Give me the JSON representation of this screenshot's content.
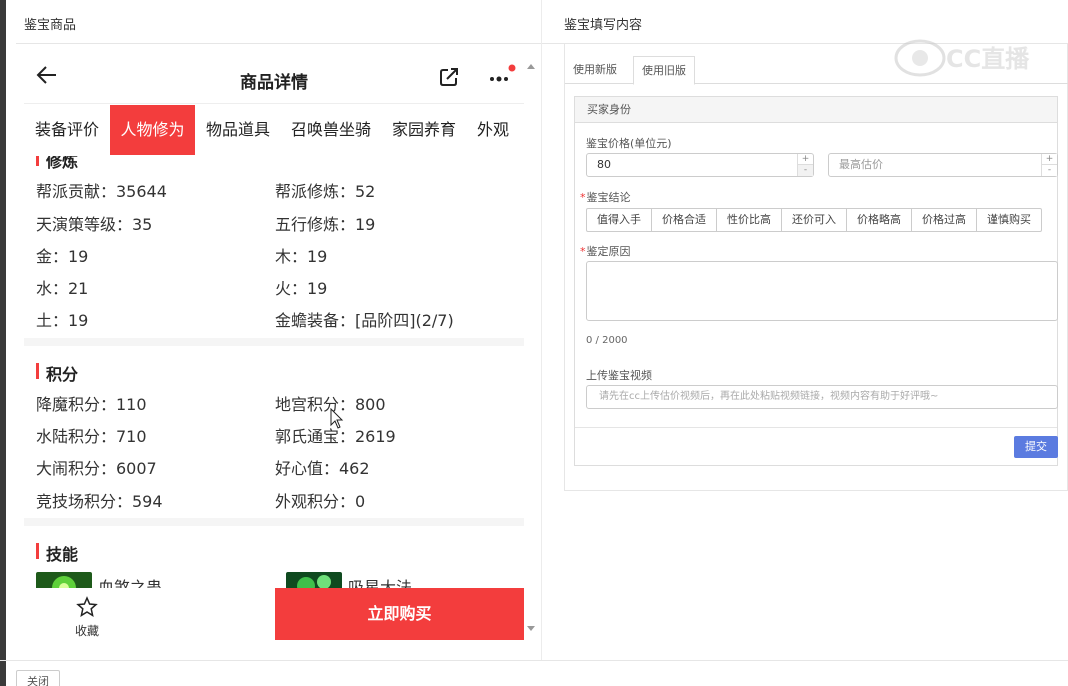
{
  "left_panel": {
    "title": "鉴宝商品"
  },
  "right_panel": {
    "title": "鉴宝填写内容"
  },
  "product": {
    "title": "商品详情",
    "tabs": [
      {
        "label": "装备评价"
      },
      {
        "label": "人物修为"
      },
      {
        "label": "物品道具"
      },
      {
        "label": "召唤兽坐骑"
      },
      {
        "label": "家园养育"
      },
      {
        "label": "外观"
      }
    ],
    "active_tab": "人物修为",
    "cultivation": {
      "title": "修炼",
      "rows": [
        [
          "帮派贡献：35644",
          "帮派修炼：52"
        ],
        [
          "天演策等级：35",
          "五行修炼：19"
        ],
        [
          "金：19",
          "木：19"
        ],
        [
          "水：21",
          "火：19"
        ],
        [
          "土：19",
          "金蟾装备：[品阶四](2/7)"
        ]
      ]
    },
    "points": {
      "title": "积分",
      "rows": [
        [
          "降魔积分：110",
          "地宫积分：800"
        ],
        [
          "水陆积分：710",
          "郭氏通宝：2619"
        ],
        [
          "大闹积分：6007",
          "好心值：462"
        ],
        [
          "竞技场积分：594",
          "外观积分：0"
        ]
      ]
    },
    "skills": {
      "title": "技能",
      "items": [
        {
          "name": "血煞之蛊"
        },
        {
          "name": "吸星大法"
        }
      ]
    },
    "favorite_label": "收藏",
    "buy_label": "立即购买"
  },
  "form": {
    "tabs": [
      {
        "label": "使用新版"
      },
      {
        "label": "使用旧版"
      }
    ],
    "active_tab": "使用旧版",
    "card_title": "买家身份",
    "price_label": "鉴宝价格(单位元)",
    "price_value": "80",
    "max_price_placeholder": "最高估价",
    "spin_up": "+",
    "spin_down": "-",
    "conclusion_label": "鉴宝结论",
    "conclusion_options": [
      "值得入手",
      "价格合适",
      "性价比高",
      "还价可入",
      "价格略高",
      "价格过高",
      "谨慎购买"
    ],
    "reason_label": "鉴定原因",
    "reason_counter": "0 / 2000",
    "video_label": "上传鉴宝视频",
    "video_placeholder": "请先在cc上传估价视频后，再在此处粘贴视频链接，视频内容有助于好评哦~",
    "submit_label": "提交"
  },
  "watermark": "CC直播",
  "close_label": "关闭",
  "colors": {
    "accent_red": "#f33d3d",
    "submit_blue": "#5b7be0"
  }
}
